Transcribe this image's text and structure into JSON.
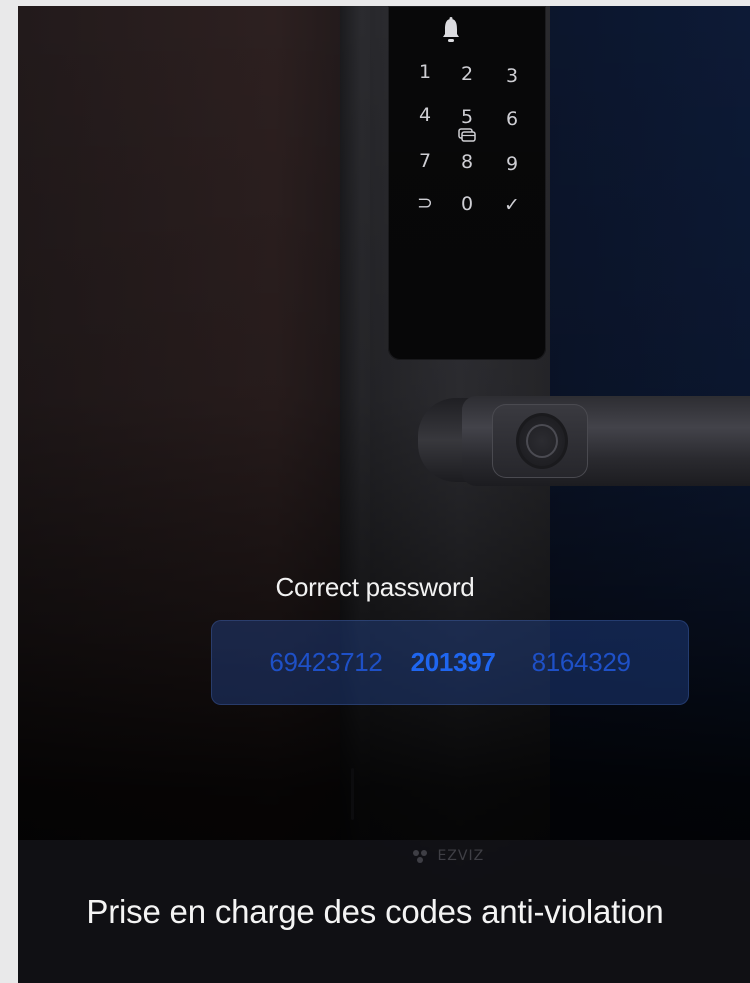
{
  "keypad": {
    "bell_icon": "bell-icon",
    "card_icon": "card-icon",
    "keys": [
      "1",
      "2",
      "3",
      "4",
      "5",
      "6",
      "7",
      "8",
      "9",
      "⊃",
      "0",
      "✓"
    ]
  },
  "brand": "EZVIZ",
  "password": {
    "title": "Correct password",
    "prefix": "69423712",
    "code": "201397",
    "suffix": "8164329",
    "code_color": "#1f66f0",
    "noise_color": "#1e50c7"
  },
  "caption": "Prise en charge des codes anti-violation"
}
